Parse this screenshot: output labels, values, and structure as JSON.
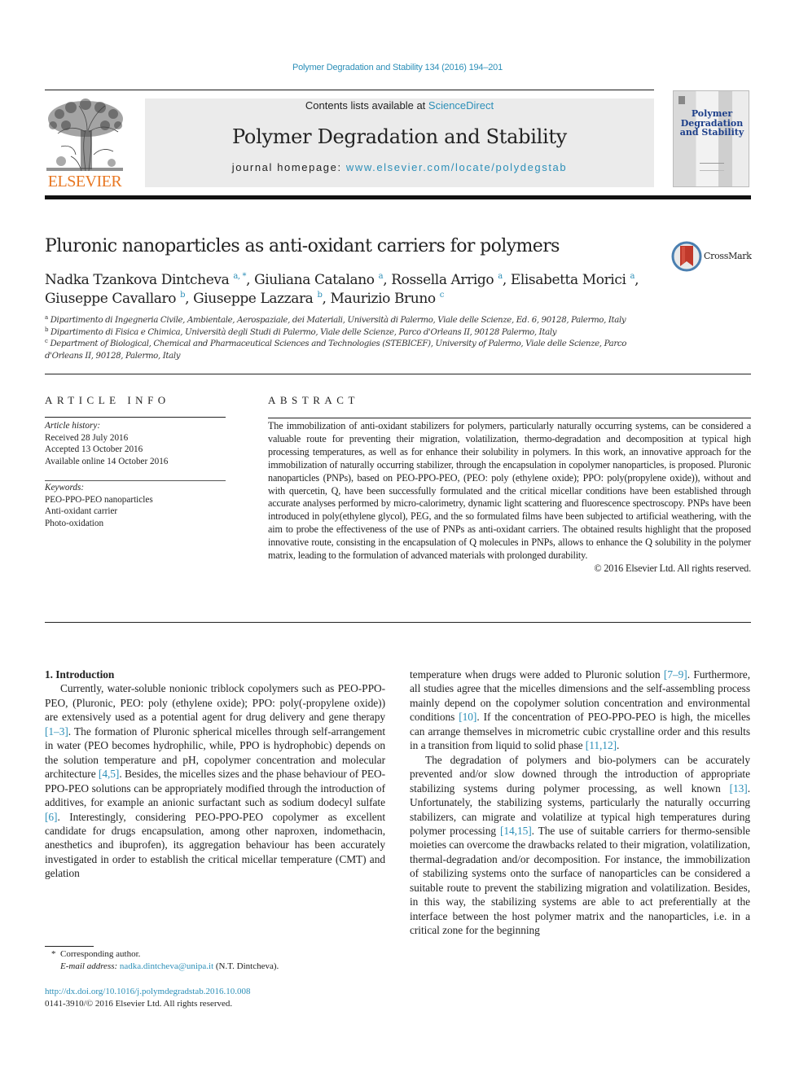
{
  "running_head": "Polymer Degradation and Stability 134 (2016) 194–201",
  "header": {
    "publisher_logo": "ELSEVIER",
    "contents_prefix": "Contents lists available at ",
    "contents_link": "ScienceDirect",
    "journal_title": "Polymer Degradation and Stability",
    "homepage_prefix": "journal homepage: ",
    "homepage_link": "www.elsevier.com/locate/polydegstab",
    "cover_title": "Polymer Degradation and Stability",
    "colors": {
      "link": "#2c8fb8",
      "elsevier_orange": "#e87722",
      "banner_bg": "#ebebeb",
      "cover_title": "#1d3f8a"
    }
  },
  "article": {
    "title": "Pluronic nanoparticles as anti-oxidant carriers for polymers",
    "crossmark_label": "CrossMark",
    "authors": [
      {
        "name": "Nadka Tzankova Dintcheva",
        "sup": "a, *",
        "sep": ", "
      },
      {
        "name": "Giuliana Catalano",
        "sup": "a",
        "sep": ", "
      },
      {
        "name": "Rossella Arrigo",
        "sup": "a",
        "sep": ", "
      },
      {
        "name": "Elisabetta Morici",
        "sup": "a",
        "sep": ","
      },
      {
        "name": "Giuseppe Cavallaro",
        "sup": "b",
        "sep": ", "
      },
      {
        "name": "Giuseppe Lazzara",
        "sup": "b",
        "sep": ", "
      },
      {
        "name": "Maurizio Bruno",
        "sup": "c",
        "sep": ""
      }
    ],
    "affiliations": [
      {
        "key": "a",
        "text": "Dipartimento di Ingegneria Civile, Ambientale, Aerospaziale, dei Materiali, Università di Palermo, Viale delle Scienze, Ed. 6, 90128, Palermo, Italy"
      },
      {
        "key": "b",
        "text": "Dipartimento di Fisica e Chimica, Università degli Studi di Palermo, Viale delle Scienze, Parco d'Orleans II, 90128 Palermo, Italy"
      },
      {
        "key": "c",
        "text": "Department of Biological, Chemical and Pharmaceutical Sciences and Technologies (STEBICEF), University of Palermo, Viale delle Scienze, Parco d'Orleans II, 90128, Palermo, Italy"
      }
    ]
  },
  "article_info": {
    "heading": "ARTICLE INFO",
    "history_label": "Article history:",
    "history": [
      "Received 28 July 2016",
      "Accepted 13 October 2016",
      "Available online 14 October 2016"
    ],
    "keywords_label": "Keywords:",
    "keywords": [
      "PEO-PPO-PEO nanoparticles",
      "Anti-oxidant carrier",
      "Photo-oxidation"
    ]
  },
  "abstract": {
    "heading": "ABSTRACT",
    "text": "The immobilization of anti-oxidant stabilizers for polymers, particularly naturally occurring systems, can be considered a valuable route for preventing their migration, volatilization, thermo-degradation and decomposition at typical high processing temperatures, as well as for enhance their solubility in polymers. In this work, an innovative approach for the immobilization of naturally occurring stabilizer, through the encapsulation in copolymer nanoparticles, is proposed. Pluronic nanoparticles (PNPs), based on PEO-PPO-PEO, (PEO: poly (ethylene oxide); PPO: poly(propylene oxide)), without and with quercetin, Q, have been successfully formulated and the critical micellar conditions have been established through accurate analyses performed by micro-calorimetry, dynamic light scattering and fluorescence spectroscopy. PNPs have been introduced in poly(ethylene glycol), PEG, and the so formulated films have been subjected to artificial weathering, with the aim to probe the effectiveness of the use of PNPs as anti-oxidant carriers. The obtained results highlight that the proposed innovative route, consisting in the encapsulation of Q molecules in PNPs, allows to enhance the Q solubility in the polymer matrix, leading to the formulation of advanced materials with prolonged durability.",
    "copyright": "© 2016 Elsevier Ltd. All rights reserved."
  },
  "body": {
    "section_title": "1.  Introduction",
    "paragraphs": [
      [
        {
          "t": "Currently, water-soluble nonionic triblock copolymers such as PEO-PPO-PEO, (Pluronic, PEO: poly (ethylene oxide); PPO: poly(propylene oxide)) are extensively used as a potential agent for drug delivery and gene therapy "
        },
        {
          "ref": "[1–3]"
        },
        {
          "t": ". The formation of Pluronic spherical micelles through self-arrangement in water (PEO becomes hydrophilic, while, PPO is hydrophobic) depends on the solution temperature and pH, copolymer concentration and molecular architecture "
        },
        {
          "ref": "[4,5]"
        },
        {
          "t": ". Besides, the micelles sizes and the phase behaviour of PEO-PPO-PEO solutions can be appropriately modified through the introduction of additives, for example an anionic surfactant such as sodium dodecyl sulfate "
        },
        {
          "ref": "[6]"
        },
        {
          "t": ". Interestingly, considering PEO-PPO-PEO copolymer as excellent candidate for drugs encapsulation, among other naproxen, indomethacin, anesthetics and ibuprofen), its aggregation behaviour has been accurately investigated in order to establish the critical micellar temperature (CMT) and gelation temperature when drugs were added to Pluronic solution "
        },
        {
          "ref": "[7–9]"
        },
        {
          "t": ". Furthermore, all studies agree that the micelles dimensions and the self-assembling process mainly depend on the copolymer solution concentration and environmental conditions "
        },
        {
          "ref": "[10]"
        },
        {
          "t": ". If the concentration of PEO-PPO-PEO is high, the micelles can arrange themselves in micrometric cubic crystalline order and this results in a transition from liquid to solid phase "
        },
        {
          "ref": "[11,12]"
        },
        {
          "t": "."
        }
      ],
      [
        {
          "t": "The degradation of polymers and bio-polymers can be accurately prevented and/or slow downed through the introduction of appropriate stabilizing systems during polymer processing, as well known "
        },
        {
          "ref": "[13]"
        },
        {
          "t": ". Unfortunately, the stabilizing systems, particularly the naturally occurring stabilizers, can migrate and volatilize at typical high temperatures during polymer processing "
        },
        {
          "ref": "[14,15]"
        },
        {
          "t": ". The use of suitable carriers for thermo-sensible moieties can overcome the drawbacks related to their migration, volatilization, thermal-degradation and/or decomposition. For instance, the immobilization of stabilizing systems onto the surface of nanoparticles can be considered a suitable route to prevent the stabilizing migration and volatilization. Besides, in this way, the stabilizing systems are able to act preferentially at the interface between the host polymer matrix and the nanoparticles, i.e. in a critical zone for the beginning"
        }
      ]
    ],
    "left_column_text_1": "Currently, water-soluble nonionic triblock copolymers such as PEO-PPO-PEO, (Pluronic, PEO: poly (ethylene oxide); PPO: poly(-propylene oxide)) are extensively used as a potential agent for drug delivery and gene therapy ",
    "left_ref_1": "[1–3]",
    "left_column_text_2": ". The formation of Pluronic spherical micelles through self-arrangement in water (PEO becomes hydrophilic, while, PPO is hydrophobic) depends on the solution temperature and pH, copolymer concentration and molecular architecture ",
    "left_ref_2": "[4,5]",
    "left_column_text_3": ". Besides, the micelles sizes and the phase behaviour of PEO-PPO-PEO solutions can be appropriately modified through the introduction of additives, for example an anionic surfactant such as sodium dodecyl sulfate ",
    "left_ref_3": "[6]",
    "left_column_text_4": ". Interestingly, considering PEO-PPO-PEO copolymer as excellent candidate for drugs encapsulation, among other naproxen, indomethacin, anesthetics and ibuprofen), its aggregation behaviour has been accurately investigated in order to establish the critical micellar temperature (CMT) and gelation",
    "right_column_text_1": "temperature when drugs were added to Pluronic solution ",
    "right_ref_1": "[7–9]",
    "right_column_text_2": ". Furthermore, all studies agree that the micelles dimensions and the self-assembling process mainly depend on the copolymer solution concentration and environmental conditions ",
    "right_ref_2": "[10]",
    "right_column_text_3": ". If the concentration of PEO-PPO-PEO is high, the micelles can arrange themselves in micrometric cubic crystalline order and this results in a transition from liquid to solid phase ",
    "right_ref_3": "[11,12]",
    "right_column_text_4": ".",
    "right_p2_text_1": "The degradation of polymers and bio-polymers can be accurately prevented and/or slow downed through the introduction of appropriate stabilizing systems during polymer processing, as well known ",
    "right_p2_ref_1": "[13]",
    "right_p2_text_2": ". Unfortunately, the stabilizing systems, particularly the naturally occurring stabilizers, can migrate and volatilize at typical high temperatures during polymer processing ",
    "right_p2_ref_2": "[14,15]",
    "right_p2_text_3": ". The use of suitable carriers for thermo-sensible moieties can overcome the drawbacks related to their migration, volatilization, thermal-degradation and/or decomposition. For instance, the immobilization of stabilizing systems onto the surface of nanoparticles can be considered a suitable route to prevent the stabilizing migration and volatilization. Besides, in this way, the stabilizing systems are able to act preferentially at the interface between the host polymer matrix and the nanoparticles, i.e. in a critical zone for the beginning"
  },
  "footnotes": {
    "star": "*",
    "corresponding": "Corresponding author.",
    "email_label": "E-mail address: ",
    "email": "nadka.dintcheva@unipa.it",
    "email_suffix": " (N.T. Dintcheva).",
    "doi": "http://dx.doi.org/10.1016/j.polymdegradstab.2016.10.008",
    "issn_line": "0141-3910/© 2016 Elsevier Ltd. All rights reserved."
  }
}
